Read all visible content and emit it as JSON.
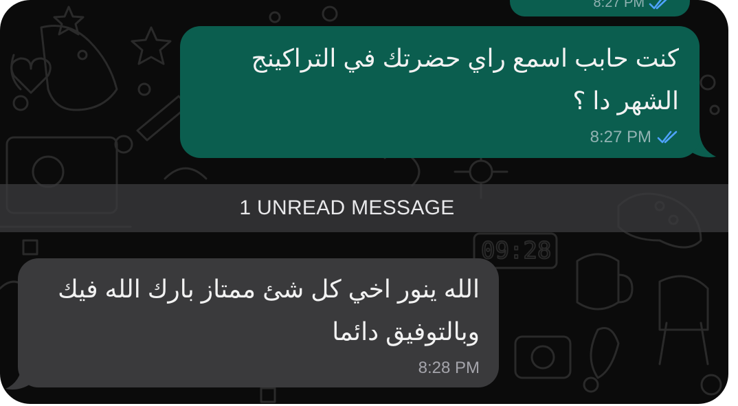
{
  "colors": {
    "background": "#0b0b0b",
    "outgoing_bubble": "#0b5e4f",
    "incoming_bubble": "#3a3a3c",
    "read_ticks": "#4fa3ff"
  },
  "previous_message": {
    "time": "8:27 PM",
    "status_icon": "double-check-read-icon"
  },
  "outgoing_message": {
    "text": "كنت حابب اسمع راي  حضرتك في التراكينج\nالشهر دا ؟",
    "time": "8:27 PM",
    "status_icon": "double-check-read-icon"
  },
  "unread_divider": {
    "label": "1 UNREAD MESSAGE"
  },
  "incoming_message": {
    "text": "الله ينور اخي كل شئ ممتاز بارك الله فيك\nوبالتوفيق دائما",
    "time": "8:28 PM"
  }
}
